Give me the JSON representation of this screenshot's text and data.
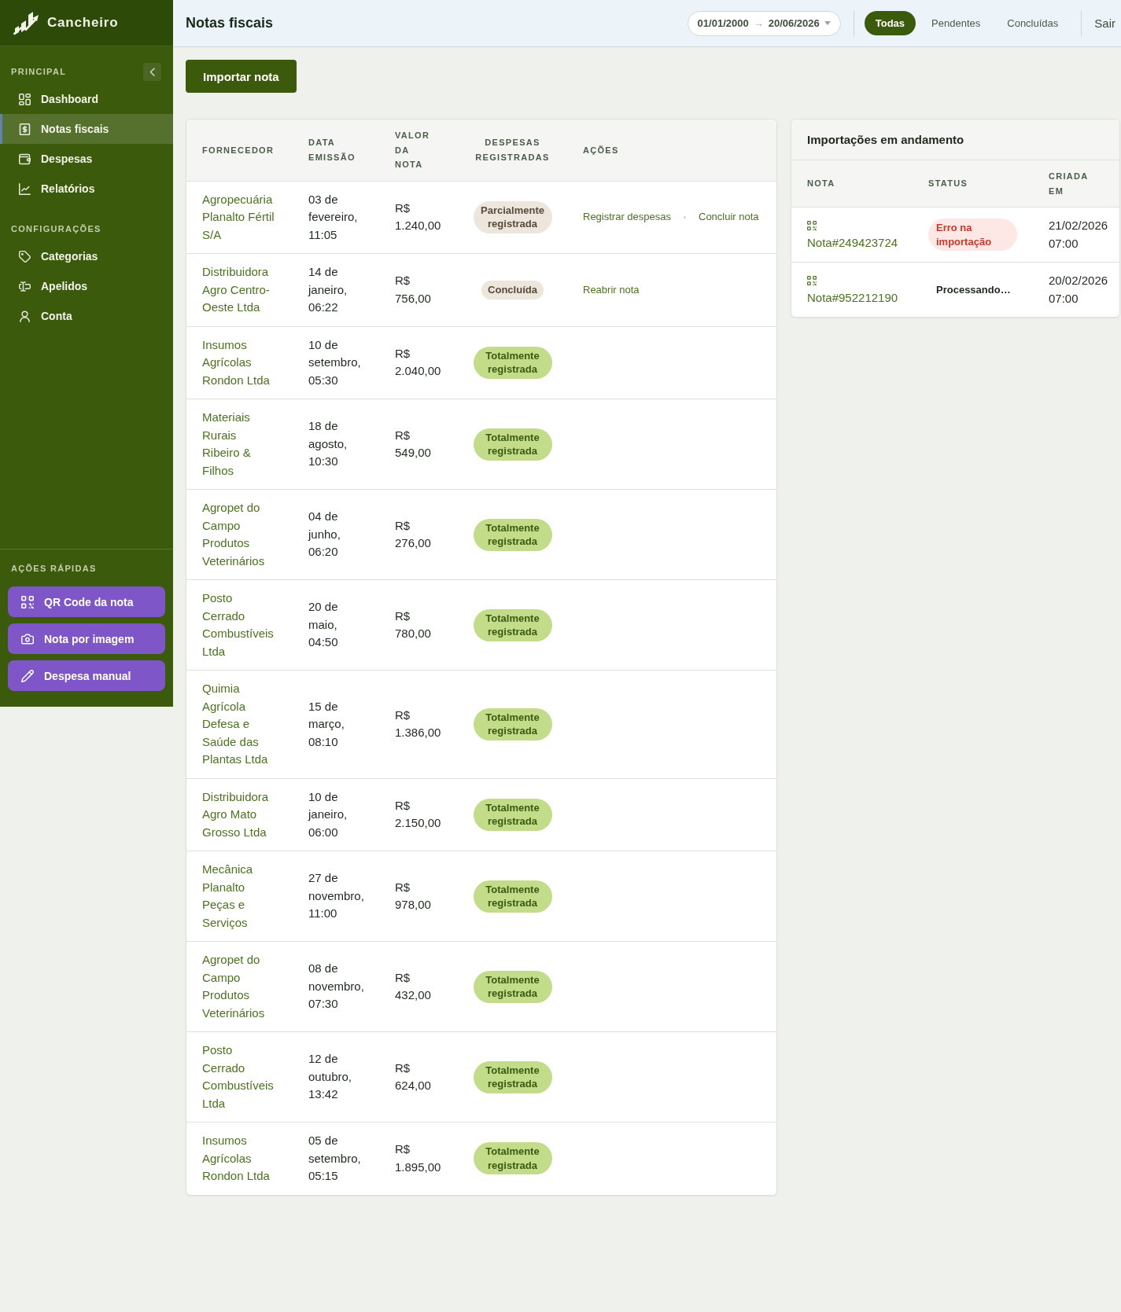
{
  "sidebar": {
    "brand": "Cancheiro",
    "sections": [
      {
        "title": "PRINCIPAL",
        "collapsible": true,
        "items": [
          {
            "label": "Dashboard",
            "selected": false
          },
          {
            "label": "Notas fiscais",
            "selected": true
          },
          {
            "label": "Despesas",
            "selected": false
          },
          {
            "label": "Relatórios",
            "selected": false
          }
        ]
      },
      {
        "title": "CONFIGURAÇÕES",
        "items": [
          {
            "label": "Categorias",
            "selected": false
          },
          {
            "label": "Apelidos",
            "selected": false
          },
          {
            "label": "Conta",
            "selected": false
          }
        ]
      }
    ],
    "quick_actions": {
      "title": "AÇÕES RÁPIDAS",
      "buttons": [
        "QR Code da nota",
        "Nota por imagem",
        "Despesa manual"
      ]
    }
  },
  "header": {
    "title": "Notas fiscais",
    "date_range": {
      "start": "01/01/2000",
      "arrow": "→",
      "end": "20/06/2026"
    },
    "filters": [
      {
        "label": "Todas",
        "selected": true
      },
      {
        "label": "Pendentes",
        "selected": false
      },
      {
        "label": "Concluídas",
        "selected": false
      }
    ],
    "logout": "Sair"
  },
  "import_button": "Importar nota",
  "invoices_table": {
    "columns": [
      "FORNECEDOR",
      "DATA EMISSÃO",
      "VALOR DA NOTA",
      "DESPESAS REGISTRADAS",
      "AÇÕES"
    ],
    "rows": [
      {
        "supplier": "Agropecuária Planalto Fértil S/A",
        "issued": "03 de fevereiro, 11:05",
        "amount": "R$ 1.240,00",
        "expenses": {
          "label": "Parcialmente registrada",
          "kind": "partial"
        },
        "actions": [
          "Registrar despesas",
          "Concluir nota"
        ]
      },
      {
        "supplier": "Distribuidora Agro Centro-Oeste Ltda",
        "issued": "14 de janeiro, 06:22",
        "amount": "R$ 756,00",
        "expenses": {
          "label": "Concluída",
          "kind": "closed"
        },
        "actions": [
          "Reabrir nota"
        ]
      },
      {
        "supplier": "Insumos Agrícolas Rondon Ltda",
        "issued": "10 de setembro, 05:30",
        "amount": "R$ 2.040,00",
        "expenses": {
          "label": "Totalmente registrada",
          "kind": "full"
        }
      },
      {
        "supplier": "Materiais Rurais Ribeiro & Filhos",
        "issued": "18 de agosto, 10:30",
        "amount": "R$ 549,00",
        "expenses": {
          "label": "Totalmente registrada",
          "kind": "full"
        }
      },
      {
        "supplier": "Agropet do Campo Produtos Veterinários",
        "issued": "04 de junho, 06:20",
        "amount": "R$ 276,00",
        "expenses": {
          "label": "Totalmente registrada",
          "kind": "full"
        }
      },
      {
        "supplier": "Posto Cerrado Combustíveis Ltda",
        "issued": "20 de maio, 04:50",
        "amount": "R$ 780,00",
        "expenses": {
          "label": "Totalmente registrada",
          "kind": "full"
        }
      },
      {
        "supplier": "Quimia Agrícola Defesa e Saúde das Plantas Ltda",
        "issued": "15 de março, 08:10",
        "amount": "R$ 1.386,00",
        "expenses": {
          "label": "Totalmente registrada",
          "kind": "full"
        }
      },
      {
        "supplier": "Distribuidora Agro Mato Grosso Ltda",
        "issued": "10 de janeiro, 06:00",
        "amount": "R$ 2.150,00",
        "expenses": {
          "label": "Totalmente registrada",
          "kind": "full"
        }
      },
      {
        "supplier": "Mecânica Planalto Peças e Serviços",
        "issued": "27 de novembro, 11:00",
        "amount": "R$ 978,00",
        "expenses": {
          "label": "Totalmente registrada",
          "kind": "full"
        }
      },
      {
        "supplier": "Agropet do Campo Produtos Veterinários",
        "issued": "08 de novembro, 07:30",
        "amount": "R$ 432,00",
        "expenses": {
          "label": "Totalmente registrada",
          "kind": "full"
        }
      },
      {
        "supplier": "Posto Cerrado Combustíveis Ltda",
        "issued": "12 de outubro, 13:42",
        "amount": "R$ 624,00",
        "expenses": {
          "label": "Totalmente registrada",
          "kind": "full"
        }
      },
      {
        "supplier": "Insumos Agrícolas Rondon Ltda",
        "issued": "05 de setembro, 05:15",
        "amount": "R$ 1.895,00",
        "expenses": {
          "label": "Totalmente registrada",
          "kind": "full"
        }
      }
    ]
  },
  "imports_panel": {
    "title": "Importações em andamento",
    "columns": [
      "NOTA",
      "STATUS",
      "CRIADA EM"
    ],
    "rows": [
      {
        "note": "Nota#249423724",
        "status": {
          "label": "Erro na importação",
          "kind": "error"
        },
        "created": "21/02/2026 07:00"
      },
      {
        "note": "Nota#952212190",
        "status": {
          "label": "Processando…",
          "kind": "processing"
        },
        "created": "20/02/2026 07:00"
      }
    ]
  }
}
